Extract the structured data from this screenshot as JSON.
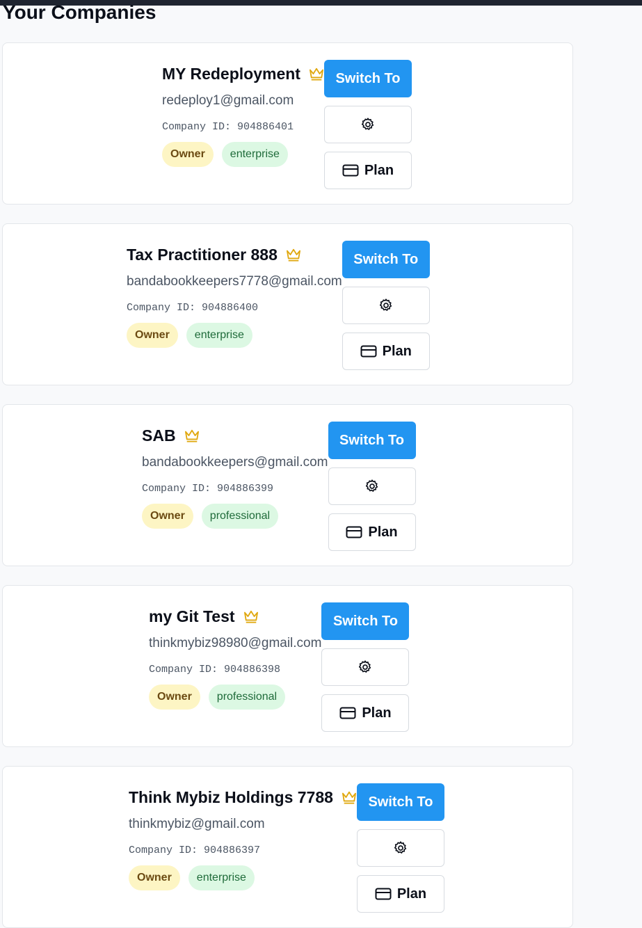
{
  "page": {
    "title": "Your Companies"
  },
  "colors": {
    "primary": "#2295f1",
    "crown": "#e0a80f",
    "owner_badge_bg": "#fdf5c4",
    "plan_badge_bg": "#dcf8e3"
  },
  "labels": {
    "switch": "Switch To",
    "plan": "Plan",
    "id_prefix": "Company ID: "
  },
  "companies": [
    {
      "name": "MY Redeployment",
      "email": "redeploy1@gmail.com",
      "company_id": "Company ID: 904886401",
      "role": "Owner",
      "plan": "enterprise"
    },
    {
      "name": "Tax Practitioner 888",
      "email": "bandabookkeepers7778@gmail.com",
      "company_id": "Company ID: 904886400",
      "role": "Owner",
      "plan": "enterprise"
    },
    {
      "name": "SAB",
      "email": "bandabookkeepers@gmail.com",
      "company_id": "Company ID: 904886399",
      "role": "Owner",
      "plan": "professional"
    },
    {
      "name": "my Git Test",
      "email": "thinkmybiz98980@gmail.com",
      "company_id": "Company ID: 904886398",
      "role": "Owner",
      "plan": "professional"
    },
    {
      "name": "Think Mybiz Holdings 7788",
      "email": "thinkmybiz@gmail.com",
      "company_id": "Company ID: 904886397",
      "role": "Owner",
      "plan": "enterprise"
    }
  ],
  "icons": {
    "crown": "crown-icon",
    "settings": "gear-icon",
    "plan": "credit-card-icon"
  }
}
